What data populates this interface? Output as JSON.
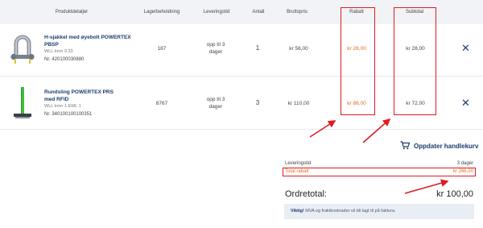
{
  "columns": {
    "product": "Produktdetaljer",
    "stock": "Lagerbeholdning",
    "delivery": "Leveringstid",
    "quantity": "Antall",
    "gross": "Bruttopris",
    "discount": "Rabatt",
    "subtotal": "Subtotal"
  },
  "items": [
    {
      "name": "H-sjakkel med øyebolt POWERTEX PBSP",
      "spec": "WLL tonn 9.33",
      "nr": "Nr. 420100030880",
      "stock": "187",
      "delivery": "opp til 3 dager",
      "quantity": "1",
      "gross": "kr 56,00",
      "discount": "kr 28,00",
      "subtotal": "kr 28,00",
      "image_icon": "shackle-icon"
    },
    {
      "name": "Rundsling POWERTEX PRS med RFID",
      "spec": "WLL tonn 1   EWL 1",
      "nr": "Nr. 340100100100351",
      "stock": "8767",
      "delivery": "opp til 3 dager",
      "quantity": "3",
      "gross": "kr 110,00",
      "discount": "kr 86,00",
      "subtotal": "kr 72,00",
      "image_icon": "round-sling-icon"
    }
  ],
  "remove_icon": "close-icon",
  "update_cart": {
    "label": "Oppdater handlekurv",
    "icon": "cart-refresh-icon"
  },
  "summary": {
    "delivery_label": "Leveringstid",
    "delivery_value": "3 dager",
    "discount_label": "Total rabatt",
    "discount_value": "kr 266,00",
    "order_total_label": "Ordretotal:",
    "order_total_value": "kr 100,00"
  },
  "notice": {
    "strong": "Viktig!",
    "text": "MVA og fraktkostnader vil bli lagt til på faktura."
  },
  "colors": {
    "brand": "#1c3a6e",
    "discount": "#e36c1c",
    "annotation": "#e01b22",
    "header_bg": "#f2f3f6",
    "notice_bg": "#e9edf4"
  }
}
